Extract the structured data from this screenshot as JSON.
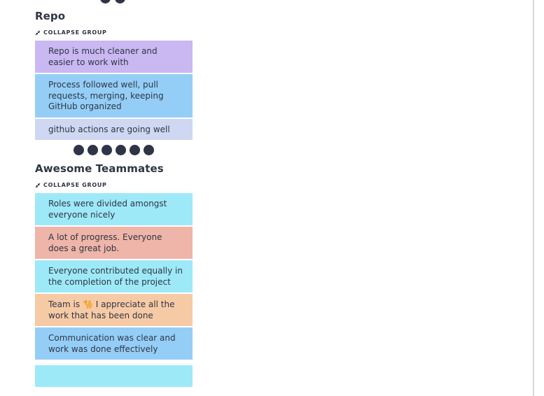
{
  "groups": [
    {
      "title": "Repo",
      "collapse_label": "COLLAPSE GROUP",
      "cards": [
        {
          "text": "Repo is much cleaner and easier to work with",
          "color": "#c9b8f2"
        },
        {
          "text": "Process followed well, pull requests, merging, keeping GitHub organized",
          "color": "#94cef7"
        },
        {
          "text": "github actions are going well",
          "color": "#cfd8f2"
        }
      ],
      "votes": 6
    },
    {
      "title": "Awesome Teammates",
      "collapse_label": "COLLAPSE GROUP",
      "cards": [
        {
          "text": "Roles were divided amongst everyone nicely",
          "color": "#9ee9f8"
        },
        {
          "text": "A lot of progress. Everyone does a great job.",
          "color": "#efb5a8"
        },
        {
          "text": "Everyone contributed equally in the completion of the project",
          "color": "#9ee9f8"
        },
        {
          "text_before": "Team is",
          "emoji": "🐪",
          "text_after": "I appreciate all the work that has been done",
          "color": "#f7caa6"
        },
        {
          "text": "Communication was clear and work was done effectively",
          "color": "#94cef7"
        }
      ]
    }
  ],
  "icons": {
    "collapse": "collapse-arrows-icon",
    "vote": "vote-dot-icon"
  }
}
